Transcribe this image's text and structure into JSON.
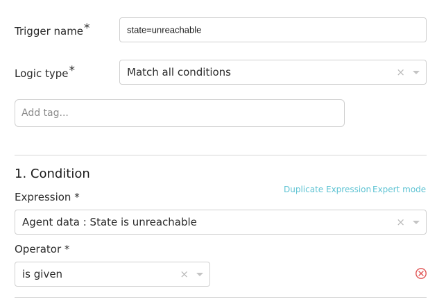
{
  "trigger": {
    "label": "Trigger name",
    "required_mark": "*",
    "value": "state=unreachable"
  },
  "logic": {
    "label": "Logic type",
    "required_mark": "*",
    "value": "Match all conditions",
    "clear_glyph": "×"
  },
  "tags": {
    "placeholder": "Add tag..."
  },
  "condition": {
    "title": "1. Condition",
    "duplicate_label": "Duplicate Expression",
    "expert_label": "Expert mode",
    "expression": {
      "label": "Expression *",
      "value": "Agent data : State is unreachable",
      "clear_glyph": "×"
    },
    "operator": {
      "label": "Operator *",
      "value": "is given",
      "clear_glyph": "×"
    },
    "remove_icon": "remove-circle-icon",
    "remove_color": "#e05252"
  },
  "colors": {
    "accent_link": "#5ec3d3",
    "border": "#cfcfcf",
    "divider": "#d6d6d6"
  }
}
